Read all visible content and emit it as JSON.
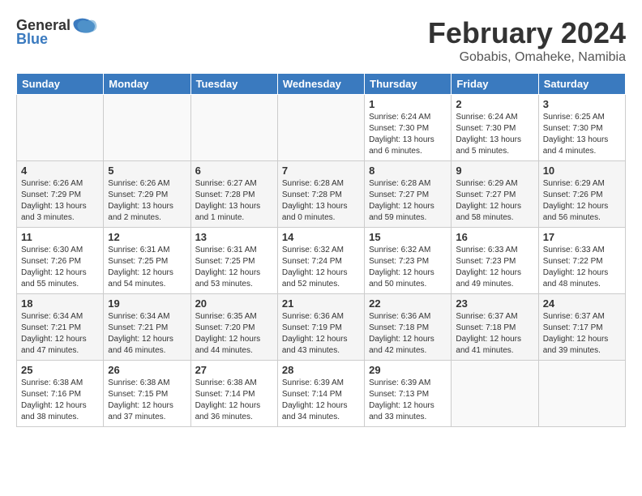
{
  "header": {
    "logo_text_general": "General",
    "logo_text_blue": "Blue",
    "month_title": "February 2024",
    "location": "Gobabis, Omaheke, Namibia"
  },
  "days_of_week": [
    "Sunday",
    "Monday",
    "Tuesday",
    "Wednesday",
    "Thursday",
    "Friday",
    "Saturday"
  ],
  "weeks": [
    [
      {
        "day": "",
        "info": ""
      },
      {
        "day": "",
        "info": ""
      },
      {
        "day": "",
        "info": ""
      },
      {
        "day": "",
        "info": ""
      },
      {
        "day": "1",
        "info": "Sunrise: 6:24 AM\nSunset: 7:30 PM\nDaylight: 13 hours\nand 6 minutes."
      },
      {
        "day": "2",
        "info": "Sunrise: 6:24 AM\nSunset: 7:30 PM\nDaylight: 13 hours\nand 5 minutes."
      },
      {
        "day": "3",
        "info": "Sunrise: 6:25 AM\nSunset: 7:30 PM\nDaylight: 13 hours\nand 4 minutes."
      }
    ],
    [
      {
        "day": "4",
        "info": "Sunrise: 6:26 AM\nSunset: 7:29 PM\nDaylight: 13 hours\nand 3 minutes."
      },
      {
        "day": "5",
        "info": "Sunrise: 6:26 AM\nSunset: 7:29 PM\nDaylight: 13 hours\nand 2 minutes."
      },
      {
        "day": "6",
        "info": "Sunrise: 6:27 AM\nSunset: 7:28 PM\nDaylight: 13 hours\nand 1 minute."
      },
      {
        "day": "7",
        "info": "Sunrise: 6:28 AM\nSunset: 7:28 PM\nDaylight: 13 hours\nand 0 minutes."
      },
      {
        "day": "8",
        "info": "Sunrise: 6:28 AM\nSunset: 7:27 PM\nDaylight: 12 hours\nand 59 minutes."
      },
      {
        "day": "9",
        "info": "Sunrise: 6:29 AM\nSunset: 7:27 PM\nDaylight: 12 hours\nand 58 minutes."
      },
      {
        "day": "10",
        "info": "Sunrise: 6:29 AM\nSunset: 7:26 PM\nDaylight: 12 hours\nand 56 minutes."
      }
    ],
    [
      {
        "day": "11",
        "info": "Sunrise: 6:30 AM\nSunset: 7:26 PM\nDaylight: 12 hours\nand 55 minutes."
      },
      {
        "day": "12",
        "info": "Sunrise: 6:31 AM\nSunset: 7:25 PM\nDaylight: 12 hours\nand 54 minutes."
      },
      {
        "day": "13",
        "info": "Sunrise: 6:31 AM\nSunset: 7:25 PM\nDaylight: 12 hours\nand 53 minutes."
      },
      {
        "day": "14",
        "info": "Sunrise: 6:32 AM\nSunset: 7:24 PM\nDaylight: 12 hours\nand 52 minutes."
      },
      {
        "day": "15",
        "info": "Sunrise: 6:32 AM\nSunset: 7:23 PM\nDaylight: 12 hours\nand 50 minutes."
      },
      {
        "day": "16",
        "info": "Sunrise: 6:33 AM\nSunset: 7:23 PM\nDaylight: 12 hours\nand 49 minutes."
      },
      {
        "day": "17",
        "info": "Sunrise: 6:33 AM\nSunset: 7:22 PM\nDaylight: 12 hours\nand 48 minutes."
      }
    ],
    [
      {
        "day": "18",
        "info": "Sunrise: 6:34 AM\nSunset: 7:21 PM\nDaylight: 12 hours\nand 47 minutes."
      },
      {
        "day": "19",
        "info": "Sunrise: 6:34 AM\nSunset: 7:21 PM\nDaylight: 12 hours\nand 46 minutes."
      },
      {
        "day": "20",
        "info": "Sunrise: 6:35 AM\nSunset: 7:20 PM\nDaylight: 12 hours\nand 44 minutes."
      },
      {
        "day": "21",
        "info": "Sunrise: 6:36 AM\nSunset: 7:19 PM\nDaylight: 12 hours\nand 43 minutes."
      },
      {
        "day": "22",
        "info": "Sunrise: 6:36 AM\nSunset: 7:18 PM\nDaylight: 12 hours\nand 42 minutes."
      },
      {
        "day": "23",
        "info": "Sunrise: 6:37 AM\nSunset: 7:18 PM\nDaylight: 12 hours\nand 41 minutes."
      },
      {
        "day": "24",
        "info": "Sunrise: 6:37 AM\nSunset: 7:17 PM\nDaylight: 12 hours\nand 39 minutes."
      }
    ],
    [
      {
        "day": "25",
        "info": "Sunrise: 6:38 AM\nSunset: 7:16 PM\nDaylight: 12 hours\nand 38 minutes."
      },
      {
        "day": "26",
        "info": "Sunrise: 6:38 AM\nSunset: 7:15 PM\nDaylight: 12 hours\nand 37 minutes."
      },
      {
        "day": "27",
        "info": "Sunrise: 6:38 AM\nSunset: 7:14 PM\nDaylight: 12 hours\nand 36 minutes."
      },
      {
        "day": "28",
        "info": "Sunrise: 6:39 AM\nSunset: 7:14 PM\nDaylight: 12 hours\nand 34 minutes."
      },
      {
        "day": "29",
        "info": "Sunrise: 6:39 AM\nSunset: 7:13 PM\nDaylight: 12 hours\nand 33 minutes."
      },
      {
        "day": "",
        "info": ""
      },
      {
        "day": "",
        "info": ""
      }
    ]
  ]
}
